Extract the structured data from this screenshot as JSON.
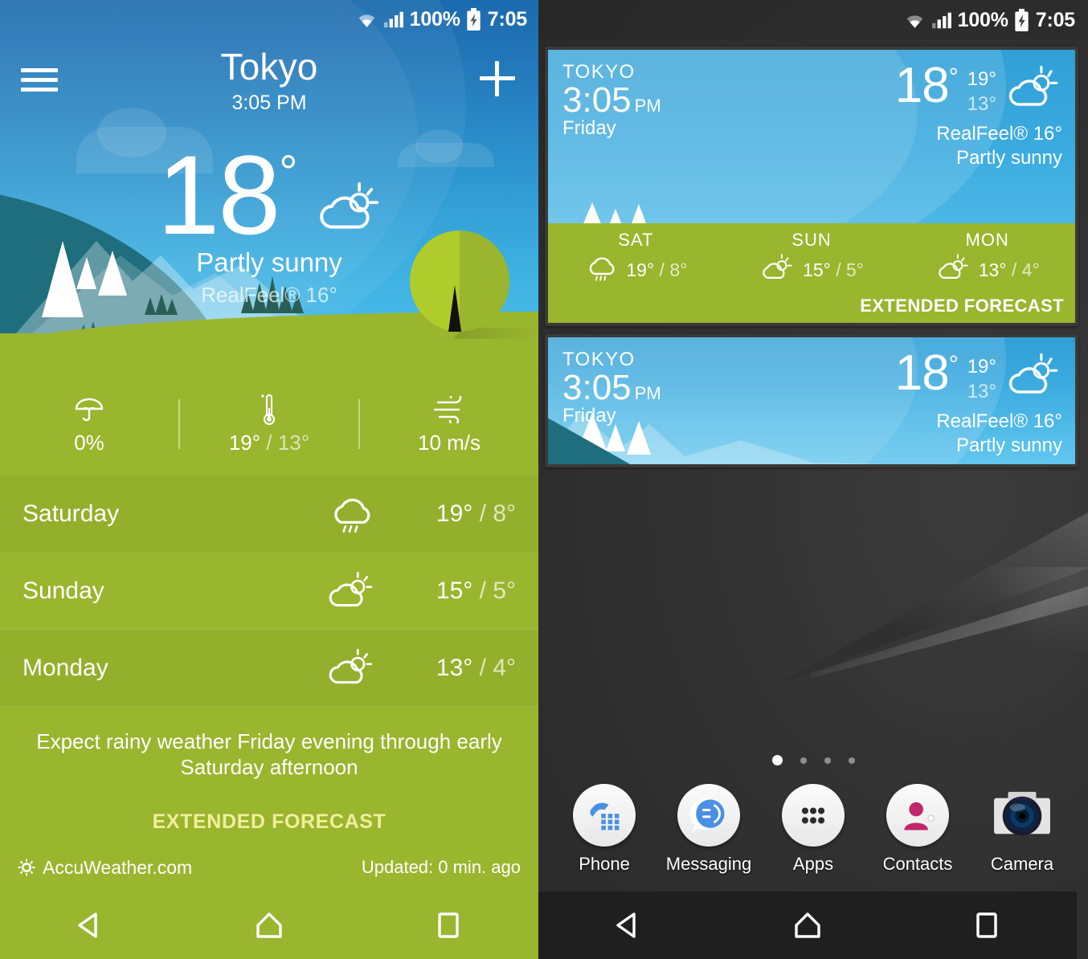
{
  "statusbar": {
    "battery_percent": "100%",
    "clock": "7:05",
    "wifi_icon": "wifi-icon",
    "signal_icon": "signal-bars-icon",
    "battery_icon": "battery-charging-icon"
  },
  "app": {
    "menu_icon": "hamburger-menu-icon",
    "add_icon": "plus-icon",
    "city": "Tokyo",
    "local_time": "3:05 PM",
    "temperature": "18",
    "degree": "°",
    "condition": "Partly sunny",
    "realfeel": "RealFeel® 16°",
    "hero_weather_icon": "partly-sunny-icon",
    "stats": [
      {
        "icon": "umbrella-precipitation-icon",
        "value": "0%",
        "name": "precipitation"
      },
      {
        "icon": "thermometer-icon",
        "high": "19°",
        "sep": " / ",
        "low": "13°",
        "name": "high-low-temperature"
      },
      {
        "icon": "wind-icon",
        "value": "10 m/s",
        "name": "wind-speed"
      }
    ],
    "forecast": [
      {
        "day": "Saturday",
        "icon": "rain-icon",
        "high": "19°",
        "sep": " / ",
        "low": "8°"
      },
      {
        "day": "Sunday",
        "icon": "partly-sunny-icon",
        "high": "15°",
        "sep": " / ",
        "low": "5°"
      },
      {
        "day": "Monday",
        "icon": "partly-sunny-icon",
        "high": "13°",
        "sep": " / ",
        "low": "4°"
      }
    ],
    "summary": "Expect rainy weather Friday evening through early Saturday afternoon",
    "extended_forecast": "EXTENDED FORECAST",
    "brand": "AccuWeather.com",
    "brand_icon": "accuweather-sun-icon",
    "updated": "Updated: 0 min. ago"
  },
  "home": {
    "widget_large": {
      "city": "TOKYO",
      "time": "3:05",
      "ampm": "PM",
      "day": "Friday",
      "temperature": "18",
      "degree": "°",
      "high": "19°",
      "low": "13°",
      "realfeel": "RealFeel® 16°",
      "condition": "Partly sunny",
      "weather_icon": "partly-sunny-icon",
      "forecast": [
        {
          "day": "SAT",
          "icon": "rain-icon",
          "high": "19°",
          "sep": " / ",
          "low": "8°"
        },
        {
          "day": "SUN",
          "icon": "partly-sunny-icon",
          "high": "15°",
          "sep": " / ",
          "low": "5°"
        },
        {
          "day": "MON",
          "icon": "partly-sunny-icon",
          "high": "13°",
          "sep": " / ",
          "low": "4°"
        }
      ],
      "extended_forecast": "EXTENDED FORECAST"
    },
    "widget_small": {
      "city": "TOKYO",
      "time": "3:05",
      "ampm": "PM",
      "day": "Friday",
      "temperature": "18",
      "degree": "°",
      "high": "19°",
      "low": "13°",
      "realfeel": "RealFeel® 16°",
      "condition": "Partly sunny",
      "weather_icon": "partly-sunny-icon"
    },
    "page_dots": {
      "count": 4,
      "active_index": 0
    },
    "dock": [
      {
        "label": "Phone",
        "icon": "phone-icon"
      },
      {
        "label": "Messaging",
        "icon": "messaging-icon"
      },
      {
        "label": "Apps",
        "icon": "apps-grid-icon"
      },
      {
        "label": "Contacts",
        "icon": "contacts-person-icon"
      },
      {
        "label": "Camera",
        "icon": "camera-icon"
      }
    ]
  },
  "navbar": {
    "back_icon": "back-triangle-icon",
    "home_icon": "home-pentagon-icon",
    "recents_icon": "recents-square-icon"
  },
  "colors": {
    "green": "#9AB52E",
    "sky_top": "#1B6AAD",
    "sky_bottom": "#49BBE9",
    "widget_sky": "#3AAADF",
    "teal": "#1E6E7D",
    "accent_yellow": "#F2EE9E",
    "wallpaper": "#2E2E2E",
    "dock_blue": "#4A90E2",
    "contacts_magenta": "#C2266D"
  }
}
